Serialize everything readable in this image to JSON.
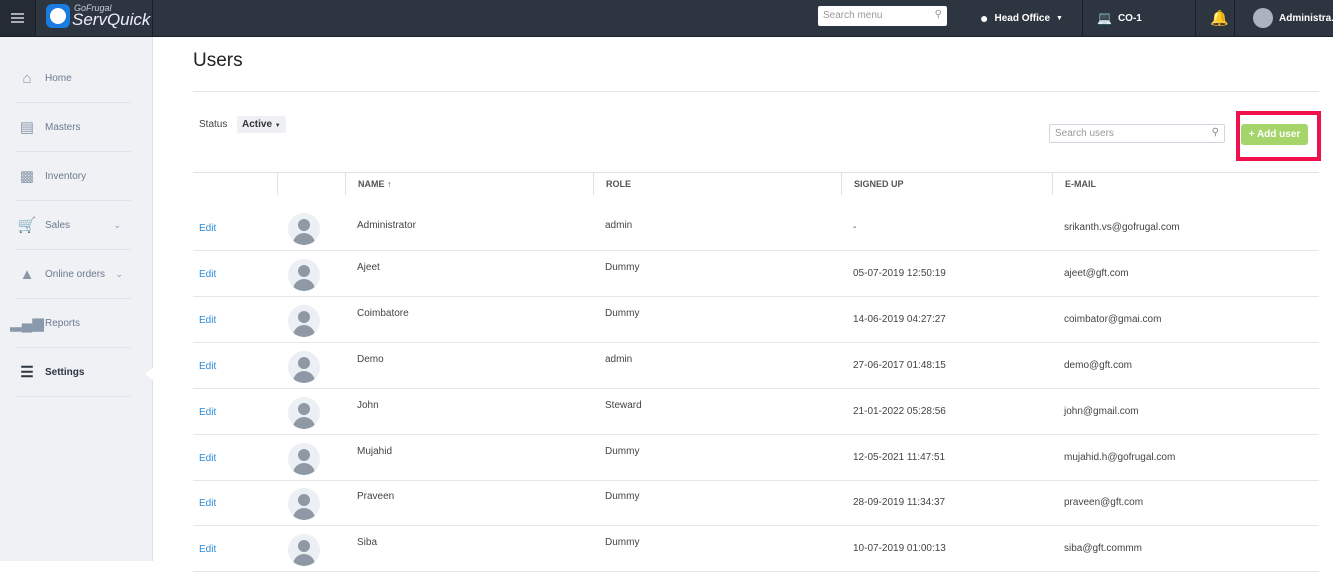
{
  "header": {
    "logo_top": "GoFrugal",
    "logo_main": "ServQuick",
    "search_placeholder": "Search menu",
    "location": "Head Office",
    "counter": "CO-1",
    "user": "Administra.."
  },
  "sidebar": {
    "items": [
      {
        "label": "Home",
        "icon": "home-icon"
      },
      {
        "label": "Masters",
        "icon": "masters-icon"
      },
      {
        "label": "Inventory",
        "icon": "inventory-icon"
      },
      {
        "label": "Sales",
        "icon": "cart-icon"
      },
      {
        "label": "Online orders",
        "icon": "online-orders-icon"
      },
      {
        "label": "Reports",
        "icon": "reports-icon"
      },
      {
        "label": "Settings",
        "icon": "settings-icon"
      }
    ]
  },
  "page": {
    "title": "Users",
    "status_label": "Status",
    "status_value": "Active",
    "search_placeholder": "Search users",
    "add_user": "+ Add user"
  },
  "table": {
    "headers": [
      "NAME ↑",
      "ROLE",
      "SIGNED UP",
      "E-MAIL"
    ],
    "edit_label": "Edit",
    "rows": [
      {
        "name": "Administrator",
        "role": "admin",
        "signed_up": "-",
        "email": "srikanth.vs@gofrugal.com"
      },
      {
        "name": "Ajeet",
        "role": "Dummy",
        "signed_up": "05-07-2019 12:50:19",
        "email": "ajeet@gft.com"
      },
      {
        "name": "Coimbatore",
        "role": "Dummy",
        "signed_up": "14-06-2019 04:27:27",
        "email": "coimbator@gmai.com"
      },
      {
        "name": "Demo",
        "role": "admin",
        "signed_up": "27-06-2017 01:48:15",
        "email": "demo@gft.com"
      },
      {
        "name": "John",
        "role": "Steward",
        "signed_up": "21-01-2022 05:28:56",
        "email": "john@gmail.com"
      },
      {
        "name": "Mujahid",
        "role": "Dummy",
        "signed_up": "12-05-2021 11:47:51",
        "email": "mujahid.h@gofrugal.com"
      },
      {
        "name": "Praveen",
        "role": "Dummy",
        "signed_up": "28-09-2019 11:34:37",
        "email": "praveen@gft.com"
      },
      {
        "name": "Siba",
        "role": "Dummy",
        "signed_up": "10-07-2019 01:00:13",
        "email": "siba@gft.commm"
      }
    ]
  }
}
